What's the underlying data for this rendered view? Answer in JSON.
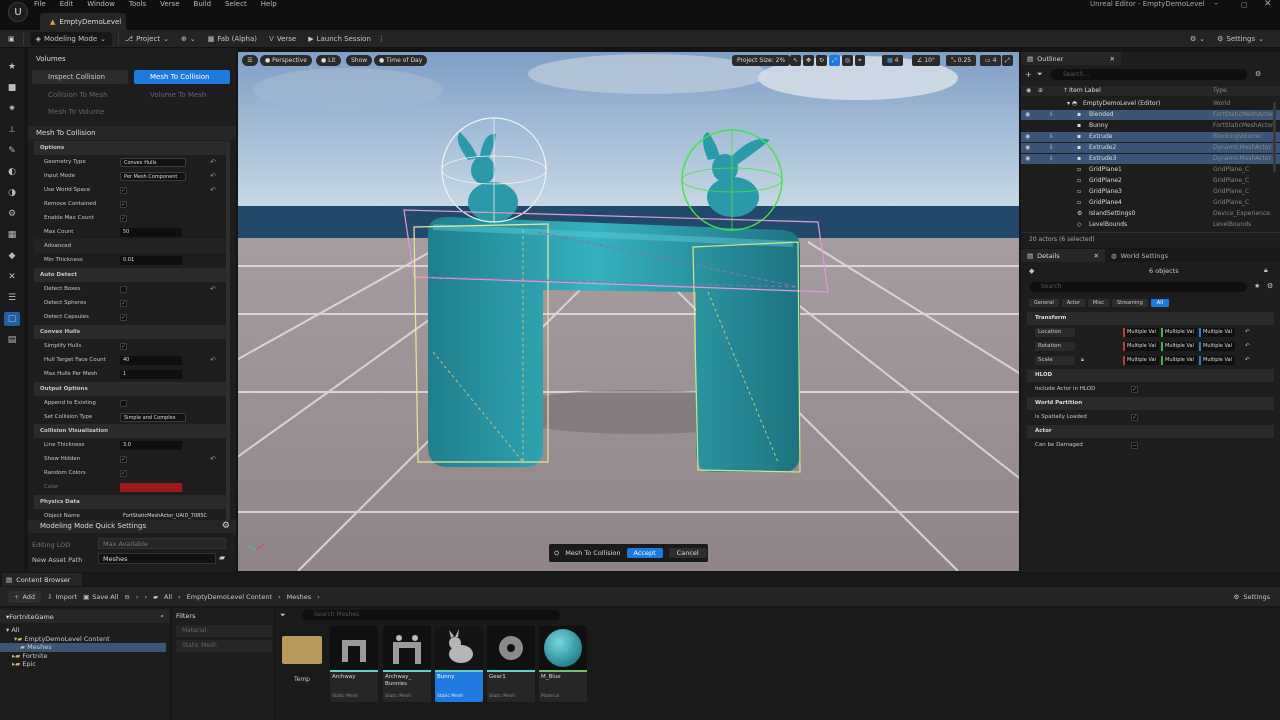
{
  "app": {
    "title": "Unreal Editor - EmptyDemoLevel",
    "logo": "U",
    "doc_tab": "EmptyDemoLevel",
    "menu": [
      "File",
      "Edit",
      "Window",
      "Tools",
      "Verse",
      "Build",
      "Select",
      "Help"
    ]
  },
  "toolbar": {
    "mode": "Modeling Mode",
    "project": "Project",
    "fab": "Fab (Alpha)",
    "verse": "Verse",
    "launch": "Launch Session",
    "settings": "Settings"
  },
  "left_panel": {
    "volumes_header": "Volumes",
    "buttons": {
      "inspect": "Inspect Collision",
      "mesh_to_collision": "Mesh To Collision",
      "collision_to_mesh": "Collision To Mesh",
      "volume_to_mesh": "Volume To Mesh",
      "mesh_to_volume": "Mesh To Volume"
    },
    "tool_header": "Mesh To Collision",
    "props": {
      "options": "Options",
      "geometry_type": "Geometry Type",
      "geometry_type_val": "Convex Hulls",
      "input_mode": "Input Mode",
      "input_mode_val": "Per Mesh Component",
      "use_world_space": "Use World Space",
      "remove_contained": "Remove Contained",
      "enable_max_count": "Enable Max Count",
      "max_count": "Max Count",
      "max_count_val": "50",
      "advanced": "Advanced",
      "min_thickness": "Min Thickness",
      "min_thickness_val": "0.01",
      "auto_detect": "Auto Detect",
      "detect_boxes": "Detect Boxes",
      "detect_spheres": "Detect Spheres",
      "detect_capsules": "Detect Capsules",
      "convex_hulls": "Convex Hulls",
      "simplify_hulls": "Simplify Hulls",
      "hull_target": "Hull Target Face Count",
      "hull_target_val": "40",
      "max_hulls": "Max Hulls Per Mesh",
      "max_hulls_val": "1",
      "output_options": "Output Options",
      "append": "Append to Existing",
      "set_collision_type": "Set Collision Type",
      "set_collision_type_val": "Simple and Complex",
      "collision_vis": "Collision Visualization",
      "line_thickness": "Line Thickness",
      "line_thickness_val": "3.0",
      "show_hidden": "Show Hidden",
      "random_colors": "Random Colors",
      "color": "Color",
      "physics_data": "Physics Data",
      "object_name": "Object Name",
      "object_name_val": "FortStaticMeshActor_UAID_7085C"
    },
    "quick_settings": "Modeling Mode Quick Settings",
    "editing_lod": "Editing LOD",
    "editing_lod_val": "Max Available",
    "new_asset_path": "New Asset Path",
    "new_asset_path_val": "Meshes",
    "color_swatch": "#9e1a1a"
  },
  "viewport": {
    "perspective": "Perspective",
    "lit": "Lit",
    "show": "Show",
    "time_of_day": "Time of Day",
    "project_size": "Project Size: 2%",
    "grid_snap": "4",
    "angle_snap": "10°",
    "scale_snap": "0.25",
    "camera_speed": "4",
    "accept_bar": {
      "label": "Mesh To Collision",
      "accept": "Accept",
      "cancel": "Cancel"
    }
  },
  "outliner": {
    "tab": "Outliner",
    "search_placeholder": "Search...",
    "col_label": "Item Label",
    "col_type": "Type",
    "rows": [
      {
        "label": "EmptyDemoLevel (Editor)",
        "type": "World"
      },
      {
        "label": "Blended",
        "type": "FortStaticMeshActor"
      },
      {
        "label": "Bunny",
        "type": "FortStaticMeshActor"
      },
      {
        "label": "Extrude",
        "type": "BlockingVolume"
      },
      {
        "label": "Extrude2",
        "type": "DynamicMeshActor"
      },
      {
        "label": "Extrude3",
        "type": "DynamicMeshActor"
      },
      {
        "label": "GridPlane1",
        "type": "GridPlane_C"
      },
      {
        "label": "GridPlane2",
        "type": "GridPlane_C"
      },
      {
        "label": "GridPlane3",
        "type": "GridPlane_C"
      },
      {
        "label": "GridPlane4",
        "type": "GridPlane_C"
      },
      {
        "label": "IslandSettings0",
        "type": "Device_Experience"
      },
      {
        "label": "LevelBounds",
        "type": "LevelBounds"
      }
    ],
    "count": "20 actors (6 selected)"
  },
  "details": {
    "tab": "Details",
    "world_settings_tab": "World Settings",
    "objects": "6 objects",
    "search_placeholder": "Search",
    "filters": [
      "General",
      "Actor",
      "Misc",
      "Streaming",
      "All"
    ],
    "transform": "Transform",
    "location": "Location",
    "rotation": "Rotation",
    "scale": "Scale",
    "multiple": "Multiple Val",
    "hlod": "HLOD",
    "include_hlod": "Include Actor in HLOD",
    "world_partition": "World Partition",
    "spatially_loaded": "Is Spatially Loaded",
    "actor": "Actor",
    "can_be_damaged": "Can be Damaged"
  },
  "content_browser": {
    "tab": "Content Browser",
    "add": "Add",
    "import": "Import",
    "save_all": "Save All",
    "path": [
      "All",
      "EmptyDemoLevel Content",
      "Meshes"
    ],
    "settings": "Settings",
    "tree_root": "FortniteGame",
    "tree": [
      "All",
      "EmptyDemoLevel Content",
      "Meshes",
      "Fortnite",
      "Epic"
    ],
    "filters_header": "Filters",
    "filters": [
      "Material",
      "Static Mesh"
    ],
    "search_placeholder": "Search Meshes",
    "assets": [
      {
        "name": "Temp",
        "type": ""
      },
      {
        "name": "Archway",
        "type": "Static Mesh"
      },
      {
        "name": "Archway_\nBunnies",
        "type": "Static Mesh"
      },
      {
        "name": "Bunny",
        "type": "Static Mesh"
      },
      {
        "name": "Gear1",
        "type": "Static Mesh"
      },
      {
        "name": "M_Blue",
        "type": "Material"
      }
    ]
  },
  "colors": {
    "accent": "#1f7ae0",
    "selection": "#3a5576",
    "teal_mesh": "#2a9aa8"
  }
}
